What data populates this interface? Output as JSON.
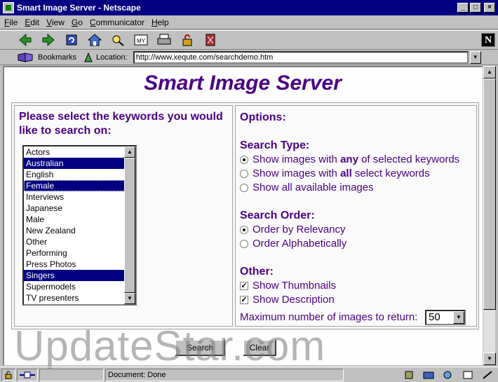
{
  "window": {
    "title": "Smart Image Server - Netscape"
  },
  "menu": {
    "items": [
      {
        "underline": "F",
        "rest": "ile"
      },
      {
        "underline": "E",
        "rest": "dit"
      },
      {
        "underline": "V",
        "rest": "iew"
      },
      {
        "underline": "G",
        "rest": "o"
      },
      {
        "underline": "C",
        "rest": "ommunicator"
      },
      {
        "underline": "H",
        "rest": "elp"
      }
    ]
  },
  "toolbar": {
    "icons": [
      "back-icon",
      "forward-icon",
      "reload-icon",
      "home-icon",
      "search-icon",
      "my-netscape-icon",
      "print-icon",
      "security-icon",
      "stop-icon"
    ],
    "my_netscape_text": "MY"
  },
  "location": {
    "bookmarks_label": "Bookmarks",
    "location_label": "Location:",
    "url": "http://www.xequte.com/searchdemo.htm"
  },
  "page": {
    "title": "Smart Image Server",
    "prompt": "Please select the keywords you would like to search on:",
    "keywords": [
      {
        "label": "Actors",
        "selected": false
      },
      {
        "label": "Australian",
        "selected": true
      },
      {
        "label": "English",
        "selected": false
      },
      {
        "label": "Female",
        "selected": true
      },
      {
        "label": "Interviews",
        "selected": false
      },
      {
        "label": "Japanese",
        "selected": false
      },
      {
        "label": "Male",
        "selected": false
      },
      {
        "label": "New Zealand",
        "selected": false
      },
      {
        "label": "Other",
        "selected": false
      },
      {
        "label": "Performing",
        "selected": false
      },
      {
        "label": "Press Photos",
        "selected": false
      },
      {
        "label": "Singers",
        "selected": true
      },
      {
        "label": "Supermodels",
        "selected": false
      },
      {
        "label": "TV presenters",
        "selected": false
      }
    ],
    "options_heading": "Options:",
    "search_type": {
      "heading": "Search Type:",
      "options": [
        {
          "pre": "Show images with ",
          "bold": "any",
          "post": " of selected keywords",
          "checked": true
        },
        {
          "pre": "Show images with ",
          "bold": "all",
          "post": " select keywords",
          "checked": false
        },
        {
          "pre": "Show all available images",
          "bold": "",
          "post": "",
          "checked": false
        }
      ]
    },
    "search_order": {
      "heading": "Search Order:",
      "options": [
        {
          "label": "Order by Relevancy",
          "checked": true
        },
        {
          "label": "Order Alphabetically",
          "checked": false
        }
      ]
    },
    "other": {
      "heading": "Other:",
      "show_thumbnails": {
        "label": "Show Thumbnails",
        "checked": true
      },
      "show_description": {
        "label": "Show Description",
        "checked": true
      }
    },
    "max_images": {
      "label": "Maximum number of images to return:",
      "value": "50"
    },
    "search_button": "Search",
    "clear_button": "Clear"
  },
  "watermark": "UpdateStar.com",
  "status": {
    "text": "Document: Done"
  },
  "colors": {
    "title_bar": "#000080",
    "page_heading": "#4b0082",
    "selection": "#000080"
  }
}
